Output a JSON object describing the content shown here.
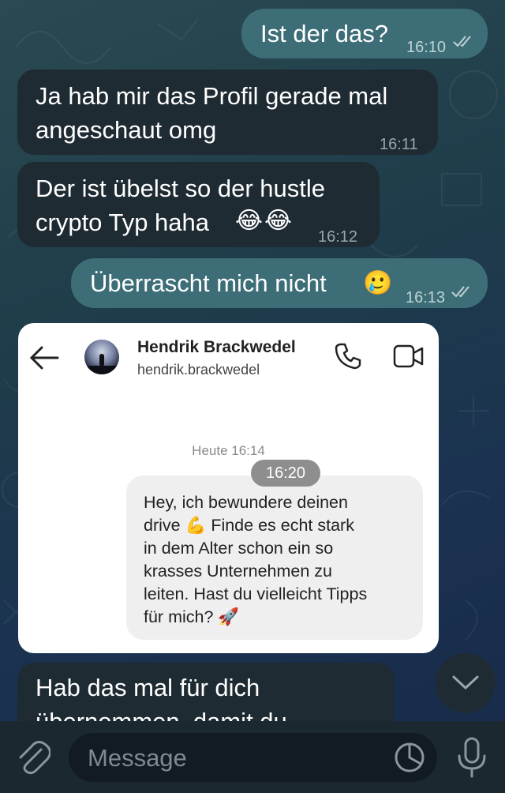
{
  "chat": {
    "messages": [
      {
        "text": "Ist der das?",
        "time": "16:10"
      },
      {
        "text1": "Ja hab mir das Profil gerade mal",
        "text2": "angeschaut omg",
        "time": "16:11"
      },
      {
        "text1": "Der ist übelst so der hustle",
        "text2": "crypto Typ haha",
        "emoji": "😂😂",
        "time": "16:12"
      },
      {
        "text": "Überrascht mich nicht",
        "emoji": "🥲",
        "time": "16:13"
      },
      {
        "text1": "Hab das mal für dich",
        "text2": "übernommen, damit du"
      }
    ]
  },
  "screenshot_card": {
    "name": "Hendrik Brackwedel",
    "handle": "hendrik.brackwedel",
    "date_label": "Heute 16:14",
    "message_lines": [
      "Hey, ich bewundere deinen",
      "drive 💪 Finde es echt stark",
      "in dem Alter schon ein so",
      "krasses Unternehmen zu",
      "leiten. Hast du vielleicht Tipps",
      "für mich? 🚀"
    ],
    "message_time": "16:20"
  },
  "composer": {
    "placeholder": "Message"
  },
  "icons": [
    "back-arrow-icon",
    "phone-icon",
    "video-icon",
    "attach-icon",
    "sticker-icon",
    "mic-icon",
    "chevron-down-icon",
    "double-check-icon"
  ],
  "colors": {
    "outgoing_bubble": "#3d6e78",
    "incoming_bubble": "#1f2b33",
    "composer_bg": "#1c2830"
  }
}
